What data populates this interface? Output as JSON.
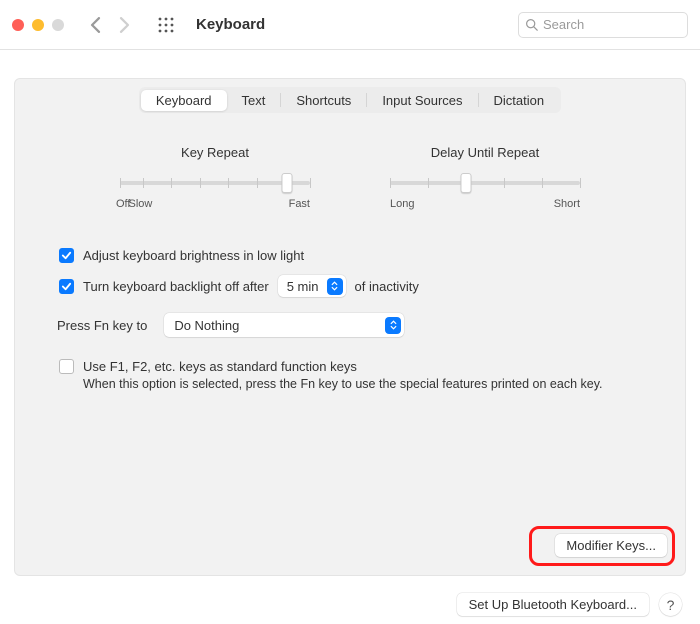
{
  "window": {
    "title": "Keyboard",
    "search_placeholder": "Search"
  },
  "tabs": {
    "keyboard": "Keyboard",
    "text": "Text",
    "shortcuts": "Shortcuts",
    "input_sources": "Input Sources",
    "dictation": "Dictation"
  },
  "sliders": {
    "key_repeat": {
      "label": "Key Repeat",
      "left": "Off",
      "left2": "Slow",
      "right": "Fast",
      "position_pct": 88
    },
    "delay_until_repeat": {
      "label": "Delay Until Repeat",
      "left": "Long",
      "right": "Short",
      "position_pct": 40
    }
  },
  "options": {
    "adjust_brightness": "Adjust keyboard brightness in low light",
    "backlight_off": {
      "prefix": "Turn keyboard backlight off after",
      "value": "5 min",
      "suffix": "of inactivity"
    },
    "press_fn": {
      "label": "Press Fn key to",
      "value": "Do Nothing"
    },
    "std_fn": {
      "label": "Use F1, F2, etc. keys as standard function keys",
      "help": "When this option is selected, press the Fn key to use the special features printed on each key."
    }
  },
  "buttons": {
    "modifier_keys": "Modifier Keys...",
    "bluetooth": "Set Up Bluetooth Keyboard...",
    "help": "?"
  }
}
